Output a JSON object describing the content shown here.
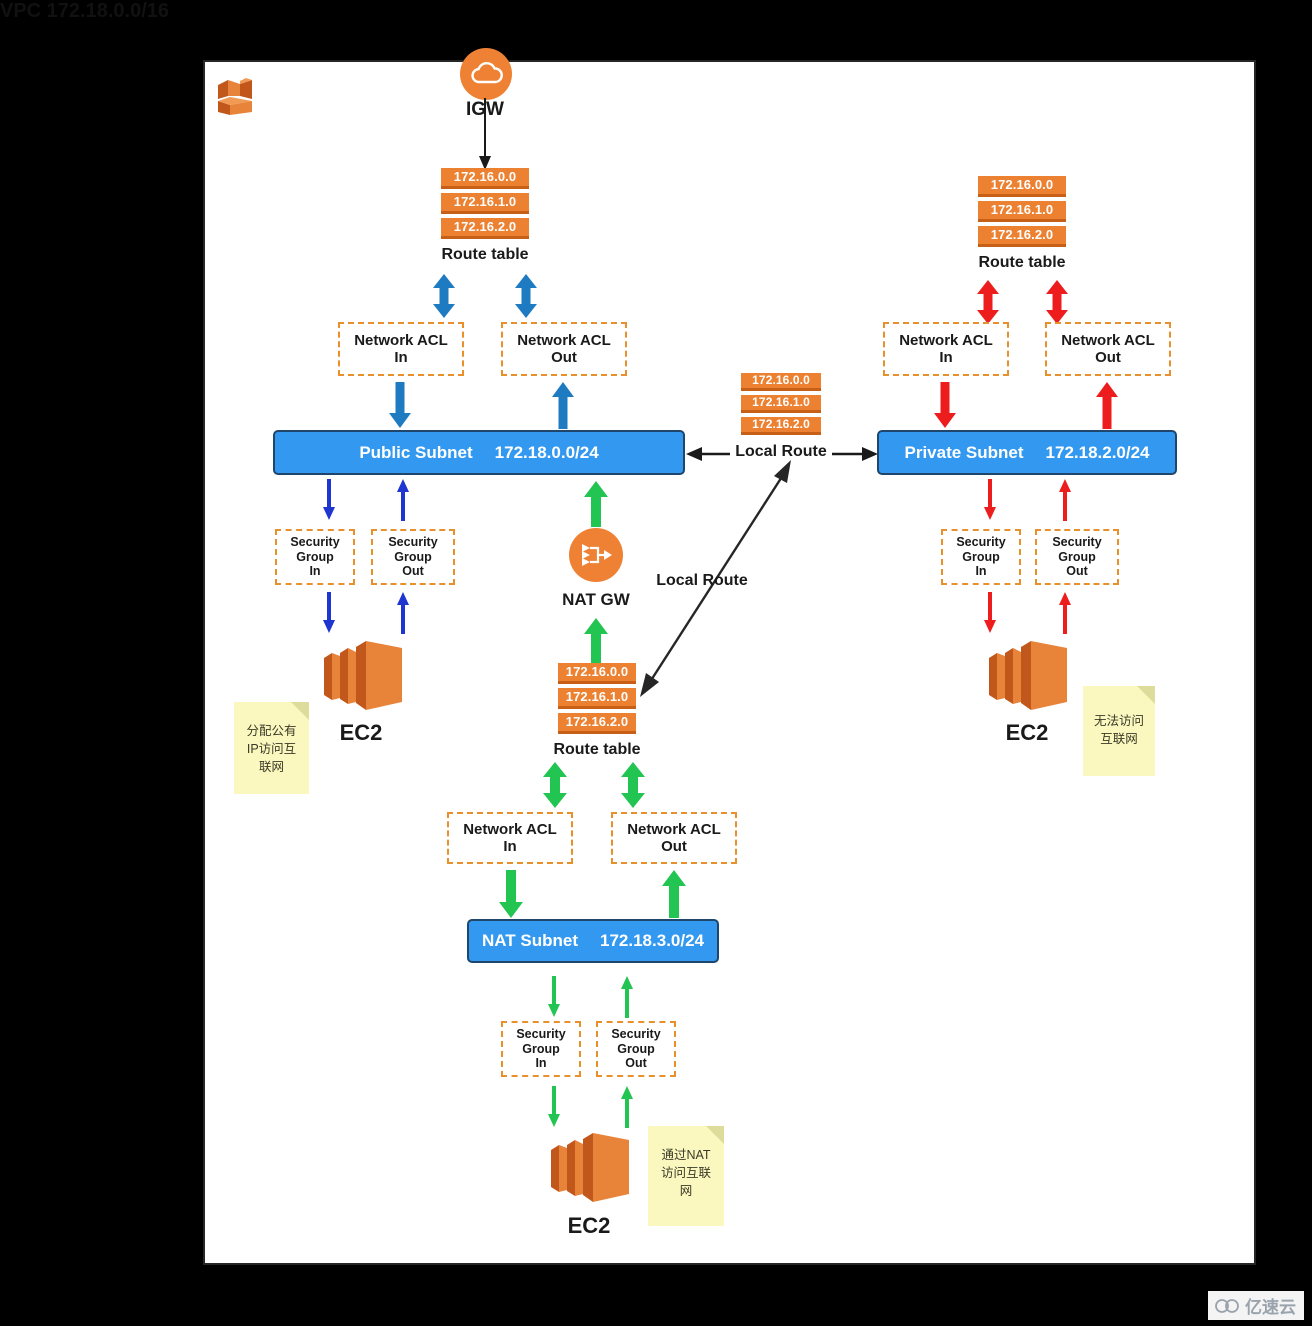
{
  "diagram": {
    "vpc_title": "VPC 172.18.0.0/16",
    "igw_label": "IGW",
    "nat_gw_label": "NAT GW",
    "route_table_caption": "Route table",
    "local_route_label": "Local Route",
    "ec2_label": "EC2",
    "route_entries": [
      "172.16.0.0",
      "172.16.1.0",
      "172.16.2.0"
    ],
    "acl_in": "Network ACL\nIn",
    "acl_out": "Network ACL\nOut",
    "acl_in_line1": "Network ACL",
    "acl_in_line2": "In",
    "acl_out_line1": "Network ACL",
    "acl_out_line2": "Out",
    "sg_in_line1": "Security",
    "sg_in_line2": "Group",
    "sg_in_line3": "In",
    "sg_out_line1": "Security",
    "sg_out_line2": "Group",
    "sg_out_line3": "Out",
    "subnets": {
      "public": {
        "name": "Public Subnet",
        "cidr": "172.18.0.0/24"
      },
      "private": {
        "name": "Private Subnet",
        "cidr": "172.18.2.0/24"
      },
      "nat": {
        "name": "NAT Subnet",
        "cidr": "172.18.3.0/24"
      }
    },
    "notes": {
      "public_ec2": [
        "分配公有",
        "IP访问互",
        "联网"
      ],
      "private_ec2": [
        "无法访问",
        "互联网"
      ],
      "nat_ec2": [
        "通过NAT",
        "访问互联",
        "网"
      ]
    },
    "watermark": "亿速云",
    "colors": {
      "aws_orange": "#ee8133",
      "route_orange": "#ec8132",
      "route_orange_dark": "#c85f16",
      "subnet_blue": "#3399f0",
      "subnet_border": "#20476b",
      "arrow_blue": "#1f7bc1",
      "arrow_blue_thin": "#1f35d0",
      "arrow_red": "#ee1d1d",
      "arrow_green": "#23c552",
      "dash_orange": "#e8902c",
      "note_yellow": "#fbf8bf",
      "canvas_bg": "#ffffff",
      "page_bg": "#000000"
    }
  }
}
